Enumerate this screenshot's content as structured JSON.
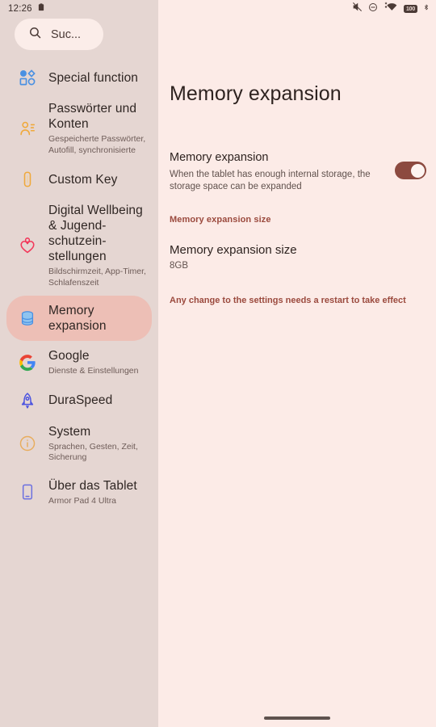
{
  "statusbar": {
    "clock": "12:26",
    "left_icons": [
      {
        "name": "clipboard-icon"
      }
    ],
    "right_icons": [
      {
        "name": "volume-mute-icon"
      },
      {
        "name": "do-not-disturb-icon"
      },
      {
        "name": "wifi-data-transfer-icon"
      },
      {
        "name": "battery-icon",
        "label": "100"
      },
      {
        "name": "bluetooth-icon"
      }
    ]
  },
  "sidebar": {
    "search": {
      "placeholder": "Suc...",
      "value": "Suc...",
      "icon": "search-icon"
    },
    "items": [
      {
        "id": "special-function",
        "icon": "shapes-icon",
        "title": "Special function",
        "subtitle": "",
        "selected": false
      },
      {
        "id": "passwords-accounts",
        "icon": "person-key-icon",
        "title": "Passwör­ter und Konten",
        "subtitle": "Gespeicherte Passwörter, Autofill, synchronisierte",
        "selected": false
      },
      {
        "id": "custom-key",
        "icon": "custom-key-icon",
        "title": "Custom Key",
        "subtitle": "",
        "selected": false
      },
      {
        "id": "digital-wellbeing",
        "icon": "heart-person-icon",
        "title": "Digital Wellbeing & Jugend­schutzein­stellungen",
        "subtitle": "Bildschirmzeit, App-Timer, Schlafenszeit",
        "selected": false
      },
      {
        "id": "memory-expansion",
        "icon": "database-icon",
        "title": "Memory expansion",
        "subtitle": "",
        "selected": true
      },
      {
        "id": "google",
        "icon": "google-g-icon",
        "title": "Google",
        "subtitle": "Dienste & Einstellungen",
        "selected": false
      },
      {
        "id": "duraspeed",
        "icon": "rocket-icon",
        "title": "DuraS­peed",
        "subtitle": "",
        "selected": false
      },
      {
        "id": "system",
        "icon": "info-circle-icon",
        "title": "System",
        "subtitle": "Sprachen, Gesten, Zeit, Sicherung",
        "selected": false
      },
      {
        "id": "about-tablet",
        "icon": "tablet-icon",
        "title": "Über das Tablet",
        "subtitle": "Armor Pad 4 Ultra",
        "selected": false
      }
    ]
  },
  "main": {
    "page_title": "Memory expansion",
    "toggle_row": {
      "title": "Memory expansion",
      "description": "When the tablet has enough internal storage, the storage space can be expanded",
      "toggle_on": true
    },
    "section_label": "Memory expansion size",
    "size_row": {
      "title": "Memory expansion size",
      "value": "8GB"
    },
    "footnote": "Any change to the settings needs a restart to take effect"
  },
  "colors": {
    "sidebar_bg": "#E5D6D2",
    "main_bg": "#FCEBE7",
    "selected_pill": "#EDBFB6",
    "accent": "#9B4A3E",
    "toggle_on": "#8C4A40",
    "search_pill_bg": "#FBEDE9"
  }
}
